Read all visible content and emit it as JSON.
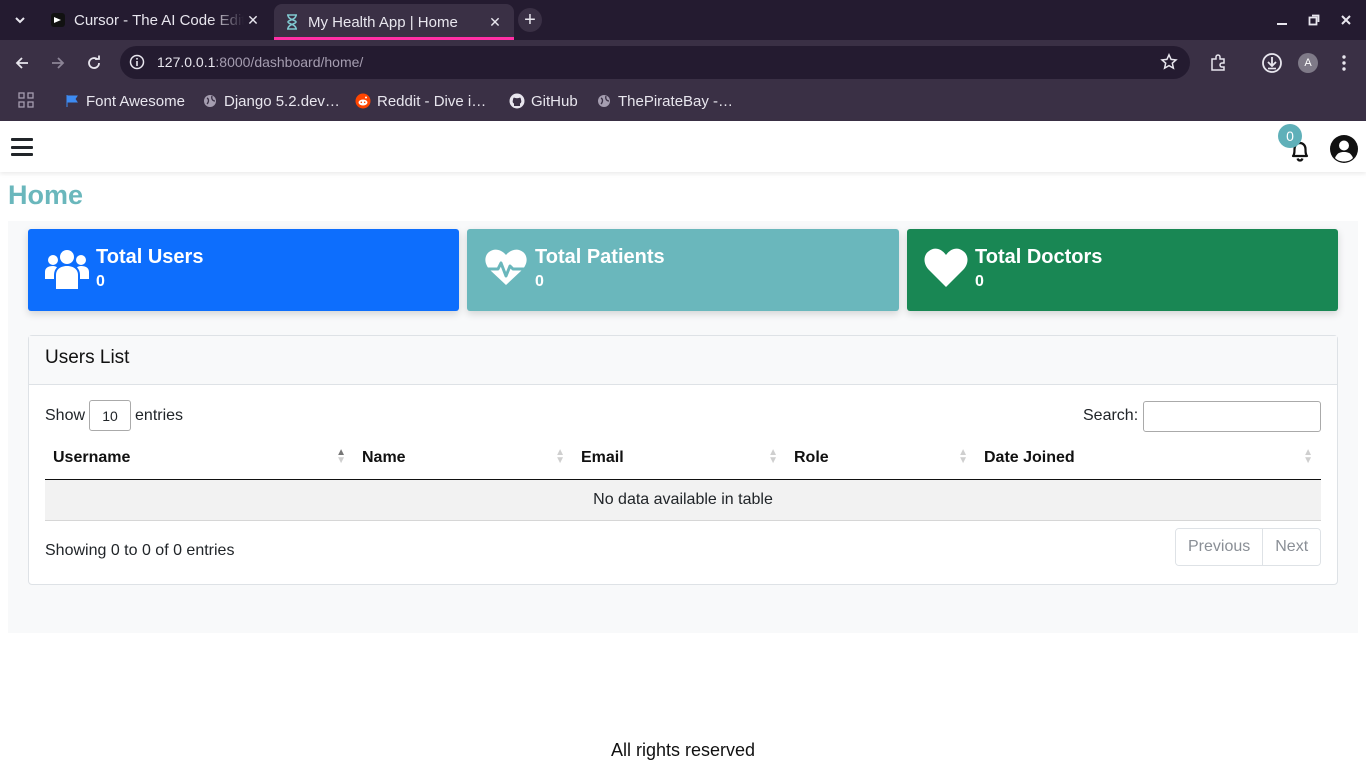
{
  "browser": {
    "tabs": [
      {
        "title": "Cursor - The AI Code Editor",
        "active": false
      },
      {
        "title": "My Health App | Home",
        "active": true
      }
    ],
    "address": {
      "host": "127.0.0.1",
      "path": ":8000/dashboard/home/"
    },
    "profile_initial": "A",
    "bookmarks": [
      {
        "label": "Font Awesome",
        "icon": "flag-icon"
      },
      {
        "label": "Django 5.2.dev…",
        "icon": "globe-icon"
      },
      {
        "label": "Reddit - Dive i…",
        "icon": "reddit-icon"
      },
      {
        "label": "GitHub",
        "icon": "github-icon"
      },
      {
        "label": "ThePirateBay -…",
        "icon": "globe-icon"
      }
    ],
    "accent_color": "#ff2fa6"
  },
  "navbar": {
    "notification_count": "0"
  },
  "page": {
    "title": "Home"
  },
  "stats": [
    {
      "label": "Total Users",
      "value": "0",
      "icon": "users-icon",
      "color": "#0d6efd"
    },
    {
      "label": "Total Patients",
      "value": "0",
      "icon": "heartbeat-icon",
      "color": "#6ab7bc"
    },
    {
      "label": "Total Doctors",
      "value": "0",
      "icon": "heart-icon",
      "color": "#198754"
    }
  ],
  "users_list": {
    "title": "Users List",
    "show_label": "Show",
    "entries_value": "10",
    "entries_label": "entries",
    "search_label": "Search:",
    "search_value": "",
    "columns": [
      "Username",
      "Name",
      "Email",
      "Role",
      "Date Joined"
    ],
    "empty_message": "No data available in table",
    "info": "Showing 0 to 0 of 0 entries",
    "pagination": {
      "previous": "Previous",
      "next": "Next"
    }
  },
  "footer": {
    "text": "All rights reserved"
  }
}
